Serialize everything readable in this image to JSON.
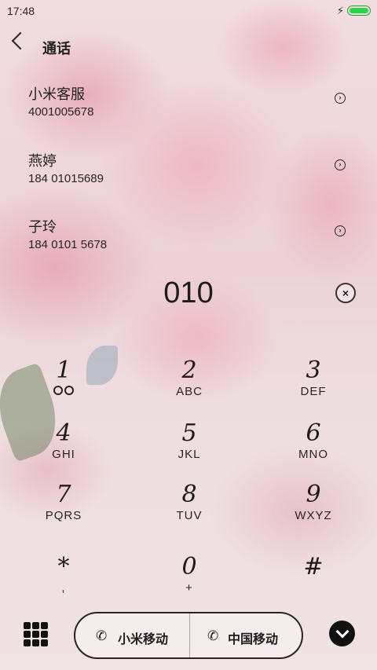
{
  "status_bar": {
    "time": "17:48",
    "charging_icon": "bolt-icon",
    "battery_color": "#2bd44a"
  },
  "header": {
    "title": "通话",
    "back_icon": "chevron-left-icon"
  },
  "contacts": [
    {
      "name": "小米客服",
      "number": "4001005678"
    },
    {
      "name": "燕婷",
      "number": "184 01015689"
    },
    {
      "name": "子玲",
      "number": "184 0101 5678"
    }
  ],
  "dial_input": {
    "value": "010"
  },
  "keypad": [
    {
      "digit": "1",
      "letters": ""
    },
    {
      "digit": "2",
      "letters": "ABC"
    },
    {
      "digit": "3",
      "letters": "DEF"
    },
    {
      "digit": "4",
      "letters": "GHI"
    },
    {
      "digit": "5",
      "letters": "JKL"
    },
    {
      "digit": "6",
      "letters": "MNO"
    },
    {
      "digit": "7",
      "letters": "PQRS"
    },
    {
      "digit": "8",
      "letters": "TUV"
    },
    {
      "digit": "9",
      "letters": "WXYZ"
    },
    {
      "digit": "*",
      "letters": ","
    },
    {
      "digit": "0",
      "letters": "+"
    },
    {
      "digit": "#",
      "letters": ""
    }
  ],
  "call_buttons": [
    {
      "sim": "1",
      "label": "小米移动"
    },
    {
      "sim": "2",
      "label": "中国移动"
    }
  ]
}
